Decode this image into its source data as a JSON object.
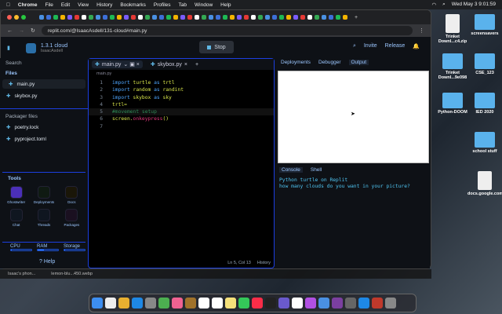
{
  "menubar": {
    "app": "Chrome",
    "items": [
      "File",
      "Edit",
      "View",
      "History",
      "Bookmarks",
      "Profiles",
      "Tab",
      "Window",
      "Help"
    ],
    "clock": "Wed May 3  9:01:59"
  },
  "browser": {
    "url": "replit.com/@IsaacAsdell/131-cloud#main.py"
  },
  "replit": {
    "project_name": "1.3.1 cloud",
    "owner": "IsaacAsdell",
    "stop_label": "Stop",
    "invite_label": "Invite",
    "release_label": "Release",
    "sidebar": {
      "search": "Search",
      "files_header": "Files",
      "files": [
        "main.py",
        "skybox.py"
      ],
      "packager_header": "Packager files",
      "packager_files": [
        "poetry.lock",
        "pyproject.toml"
      ],
      "tools_header": "Tools",
      "tools": [
        "Ghostwriter",
        "Deployments",
        "Docs",
        "Chat",
        "Threads",
        "Packages"
      ],
      "resources": [
        {
          "label": "CPU",
          "value": 0.05
        },
        {
          "label": "RAM",
          "value": 0.3
        },
        {
          "label": "Storage",
          "value": 0.05
        }
      ],
      "help": "Help"
    },
    "editor": {
      "tabs": [
        "main.py",
        "skybox.py"
      ],
      "breadcrumb": "main.py",
      "status": "Ln 5, Col 13",
      "history": "History"
    },
    "right": {
      "tabs": [
        "Deployments",
        "Debugger",
        "Output"
      ],
      "console_tabs": [
        "Console",
        "Shell"
      ],
      "console_lines": [
        "Python turtle on Replit",
        "how many clouds do you want in your picture?"
      ]
    }
  },
  "desktop": {
    "icons": [
      "Trinket Downl...c4.zip",
      "screensavers",
      "Trinket Downl...9e098",
      "CSE_123",
      "Python-DOOM",
      "IED 2020",
      "school stuff",
      "docs.google.com/"
    ]
  },
  "downloads": [
    "Isaac's phon...",
    "lemon-blu...450.webp"
  ]
}
